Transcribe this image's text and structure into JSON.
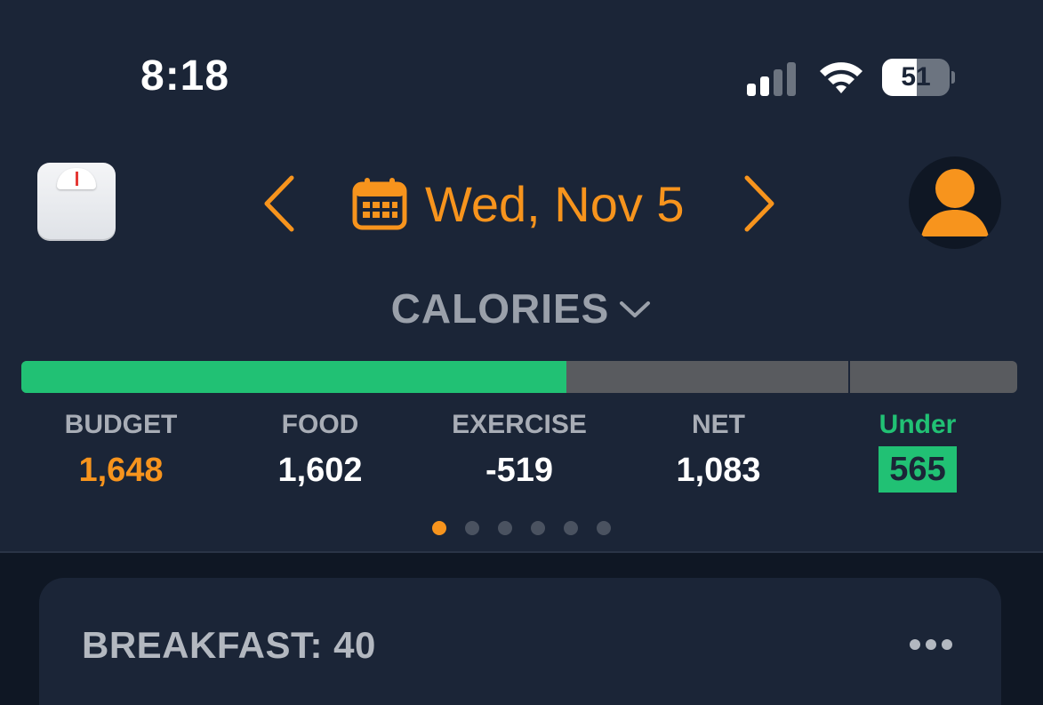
{
  "status_bar": {
    "time": "8:18",
    "battery_percent": "51",
    "battery_level": 0.51,
    "icons": [
      "signal-icon",
      "wifi-icon",
      "battery-icon"
    ]
  },
  "header": {
    "scale_icon": "scale-icon",
    "prev_icon": "chevron-left-icon",
    "date": "Wed, Nov 5",
    "calendar_icon": "calendar-icon",
    "next_icon": "chevron-right-icon",
    "profile_icon": "profile-avatar-icon"
  },
  "metric_selector": {
    "label": "CALORIES",
    "icon": "chevron-down-icon"
  },
  "progress": {
    "food_fraction": 0.547,
    "budget_marker_fraction": 0.83
  },
  "stats": [
    {
      "label": "BUDGET",
      "value": "1,648"
    },
    {
      "label": "FOOD",
      "value": "1,602"
    },
    {
      "label": "EXERCISE",
      "value": "-519"
    },
    {
      "label": "NET",
      "value": "1,083"
    },
    {
      "label": "Under",
      "value": "565"
    }
  ],
  "pager": {
    "count": 6,
    "active_index": 0
  },
  "meals": [
    {
      "title": "BREAKFAST: 40",
      "menu_icon": "more-dots-icon"
    }
  ],
  "colors": {
    "background": "#1b2537",
    "accent_orange": "#f7941d",
    "green": "#21c174",
    "track_gray": "#595b5f"
  }
}
